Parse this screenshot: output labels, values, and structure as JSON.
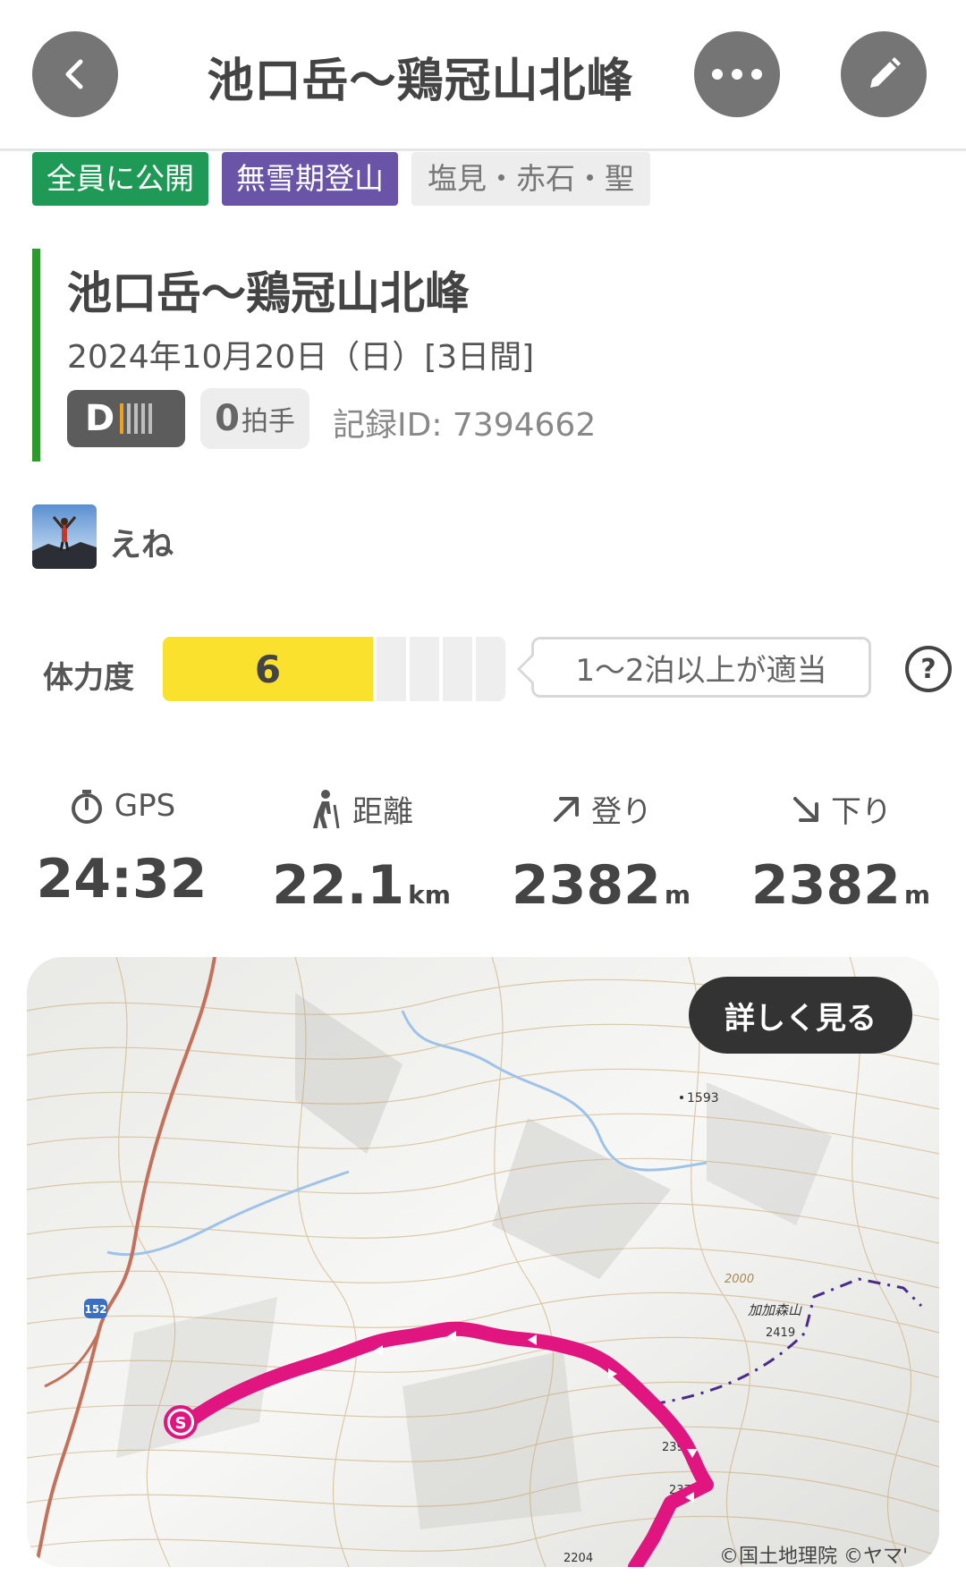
{
  "header": {
    "title": "池口岳〜鶏冠山北峰"
  },
  "tags": [
    "全員に公開",
    "無雪期登山",
    "塩見・赤石・聖"
  ],
  "record": {
    "title": "池口岳〜鶏冠山北峰",
    "date": "2024年10月20日（日）[3日間]",
    "difficulty": "D",
    "claps": "0",
    "claps_label": "拍手",
    "record_id": "記録ID: 7394662"
  },
  "user": {
    "name": "えね"
  },
  "stamina": {
    "label": "体力度",
    "value": "6",
    "note": "1〜2泊以上が適当",
    "help": "?"
  },
  "stats": [
    {
      "label": "GPS",
      "value": "24:32",
      "unit": ""
    },
    {
      "label": "距離",
      "value": "22.1",
      "unit": "km"
    },
    {
      "label": "登り",
      "value": "2382",
      "unit": "m"
    },
    {
      "label": "下り",
      "value": "2382",
      "unit": "m"
    }
  ],
  "map": {
    "button": "詳しく見る",
    "start_marker": "S",
    "route_label": "152",
    "peak_label": "加加森山",
    "peak_elev": "2419",
    "elev_1593": "1593",
    "elev_2000": "2000",
    "elev_2392": "2392",
    "elev_2376": "2376",
    "elev_2204": "2204",
    "attribution": "©国土地理院 ©ヤマ'"
  },
  "colors": {
    "track": "#e0157f",
    "public_tag": "#1f9a56",
    "season_tag": "#6a54a8",
    "stamina_fill": "#f9e12e",
    "title_bar": "#2e9a2e"
  }
}
